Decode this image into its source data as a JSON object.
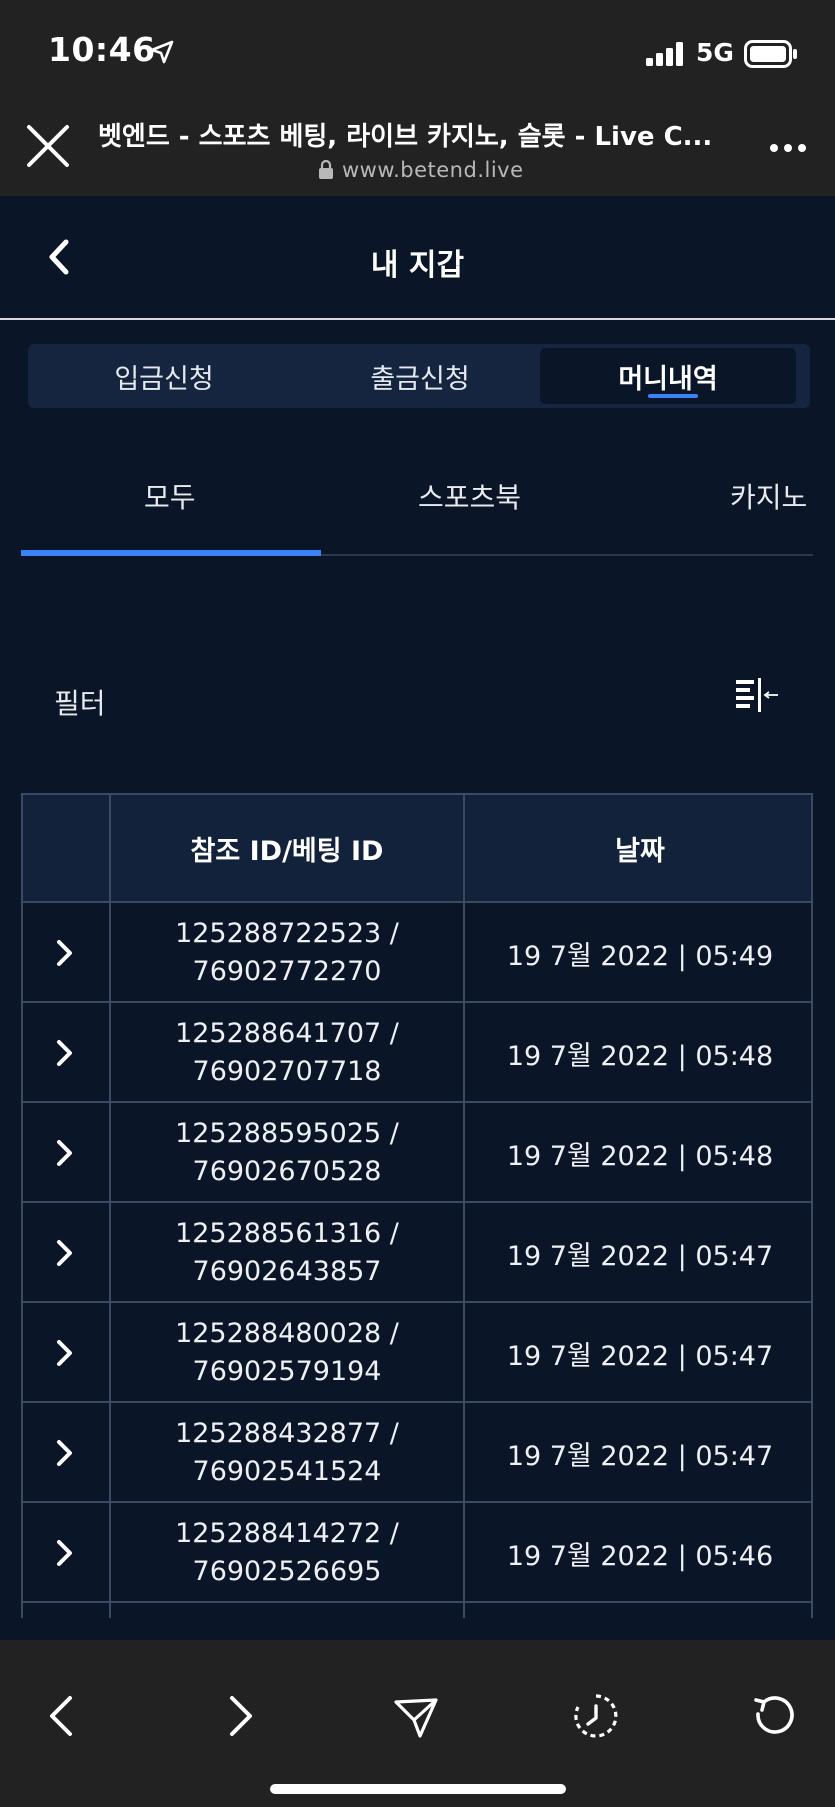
{
  "status_bar": {
    "time": "10:46",
    "network": "5G"
  },
  "browser": {
    "page_title": "벳엔드 - 스포츠 베팅, 라이브 카지노, 슬롯 - Live C...",
    "url": "www.betend.live"
  },
  "header": {
    "title": "내 지갑"
  },
  "segments": [
    {
      "label": "입금신청"
    },
    {
      "label": "출금신청"
    },
    {
      "label": "머니내역",
      "active": true
    }
  ],
  "categories": [
    {
      "label": "모두",
      "active": true
    },
    {
      "label": "스포츠북"
    },
    {
      "label": "카지노"
    }
  ],
  "filter": {
    "label": "필터"
  },
  "table": {
    "columns": [
      "",
      "참조 ID/베팅 ID",
      "날짜"
    ],
    "rows": [
      {
        "ref_id": "125288722523 /",
        "bet_id": "76902772270",
        "date": "19 7월 2022 | 05:49"
      },
      {
        "ref_id": "125288641707 /",
        "bet_id": "76902707718",
        "date": "19 7월 2022 | 05:48"
      },
      {
        "ref_id": "125288595025 /",
        "bet_id": "76902670528",
        "date": "19 7월 2022 | 05:48"
      },
      {
        "ref_id": "125288561316 /",
        "bet_id": "76902643857",
        "date": "19 7월 2022 | 05:47"
      },
      {
        "ref_id": "125288480028 /",
        "bet_id": "76902579194",
        "date": "19 7월 2022 | 05:47"
      },
      {
        "ref_id": "125288432877 /",
        "bet_id": "76902541524",
        "date": "19 7월 2022 | 05:47"
      },
      {
        "ref_id": "125288414272 /",
        "bet_id": "76902526695",
        "date": "19 7월 2022 | 05:46"
      }
    ]
  },
  "colors": {
    "background": "#0a1527",
    "accent": "#3b82f6",
    "segment_bg": "#15253f",
    "header_row": "#13223b",
    "chrome": "#222222"
  },
  "icons": {
    "close": "close-icon",
    "back": "back-arrow-icon",
    "filter": "filter-icon",
    "row_expand": "chevron-right-icon",
    "toolbar": [
      "back-icon",
      "forward-icon",
      "share-icon",
      "history-icon",
      "reload-icon"
    ]
  }
}
